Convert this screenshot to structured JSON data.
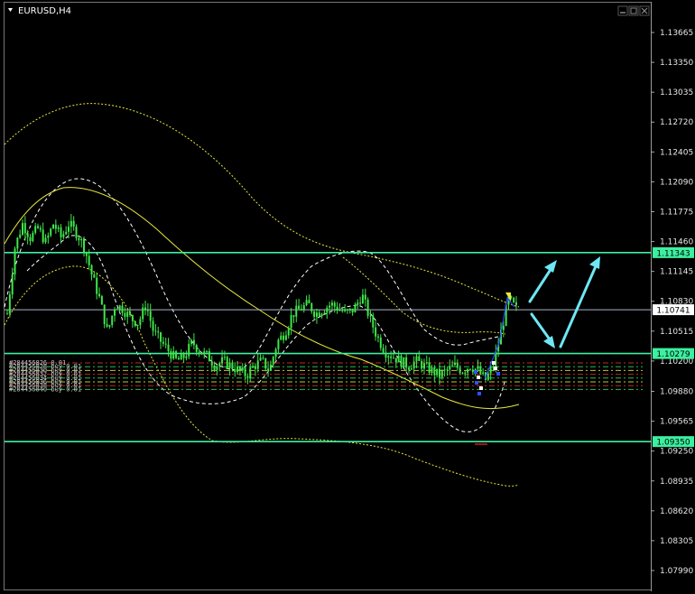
{
  "window": {
    "title": "EURUSD,H4",
    "server_time": "",
    "controls": [
      "minimize",
      "maximize",
      "close"
    ]
  },
  "colors": {
    "background": "#000000",
    "candle": "#3ee64a",
    "level_line": "#3cf0a0",
    "price_line": "#aab4c8",
    "arrow": "#6ee7f5",
    "axis_text": "#e6e6e6",
    "envelope_white": "#ffffff",
    "envelope_yellow": "#e8e83c",
    "zigzag": "#3040ff"
  },
  "chart_data": {
    "type": "candlestick",
    "symbol": "EURUSD",
    "timeframe": "H4",
    "title": "EURUSD,H4",
    "ylim": [
      1.078,
      1.1379
    ],
    "y_ticks": [
      "1.13665",
      "1.13350",
      "1.13035",
      "1.12720",
      "1.12405",
      "1.12090",
      "1.11775",
      "1.11460",
      "1.11145",
      "1.10830",
      "1.10515",
      "1.10200",
      "1.09880",
      "1.09565",
      "1.09250",
      "1.08935",
      "1.08620",
      "1.08305",
      "1.07990"
    ],
    "current_price": "1.10741",
    "levels": [
      {
        "name": "resistance",
        "price": 1.11343,
        "label": "1.11343"
      },
      {
        "name": "support",
        "price": 1.10279,
        "label": "1.10279"
      },
      {
        "name": "support-low",
        "price": 1.0935,
        "label": "1.09350"
      }
    ],
    "close_path": [
      1.107,
      1.114,
      1.1165,
      1.115,
      1.116,
      1.1145,
      1.1165,
      1.115,
      1.1165,
      1.1155,
      1.114,
      1.111,
      1.1085,
      1.105,
      1.108,
      1.1075,
      1.1065,
      1.106,
      1.108,
      1.105,
      1.104,
      1.103,
      1.102,
      1.1025,
      1.104,
      1.103,
      1.1025,
      1.1015,
      1.102,
      1.1015,
      1.101,
      1.1005,
      1.1015,
      1.102,
      1.101,
      1.104,
      1.105,
      1.107,
      1.1075,
      1.108,
      1.107,
      1.1075,
      1.108,
      1.1075,
      1.107,
      1.1075,
      1.109,
      1.1065,
      1.1045,
      1.103,
      1.1025,
      1.102,
      1.1015,
      1.102,
      1.1015,
      1.101,
      1.1005,
      1.101,
      1.1015,
      1.101,
      1.1015,
      1.101,
      1.1,
      1.1015,
      1.105,
      1.1085,
      1.1075
    ],
    "orders": [
      {
        "id": "#284456826",
        "type": "",
        "lots": "0.01"
      },
      {
        "id": "#284456828",
        "type": "buy",
        "lots": "0.01"
      },
      {
        "id": "#284456830",
        "type": "buy",
        "lots": "0.01"
      },
      {
        "id": "#284456832",
        "type": "buy",
        "lots": "0.01"
      },
      {
        "id": "#284456834",
        "type": "buy",
        "lots": "0.01"
      },
      {
        "id": "#284456836",
        "type": "buy",
        "lots": "0.01"
      },
      {
        "id": "#284456838",
        "type": "buy",
        "lots": "0.01"
      },
      {
        "id": "#284456840",
        "type": "buy",
        "lots": "0.01"
      }
    ]
  }
}
